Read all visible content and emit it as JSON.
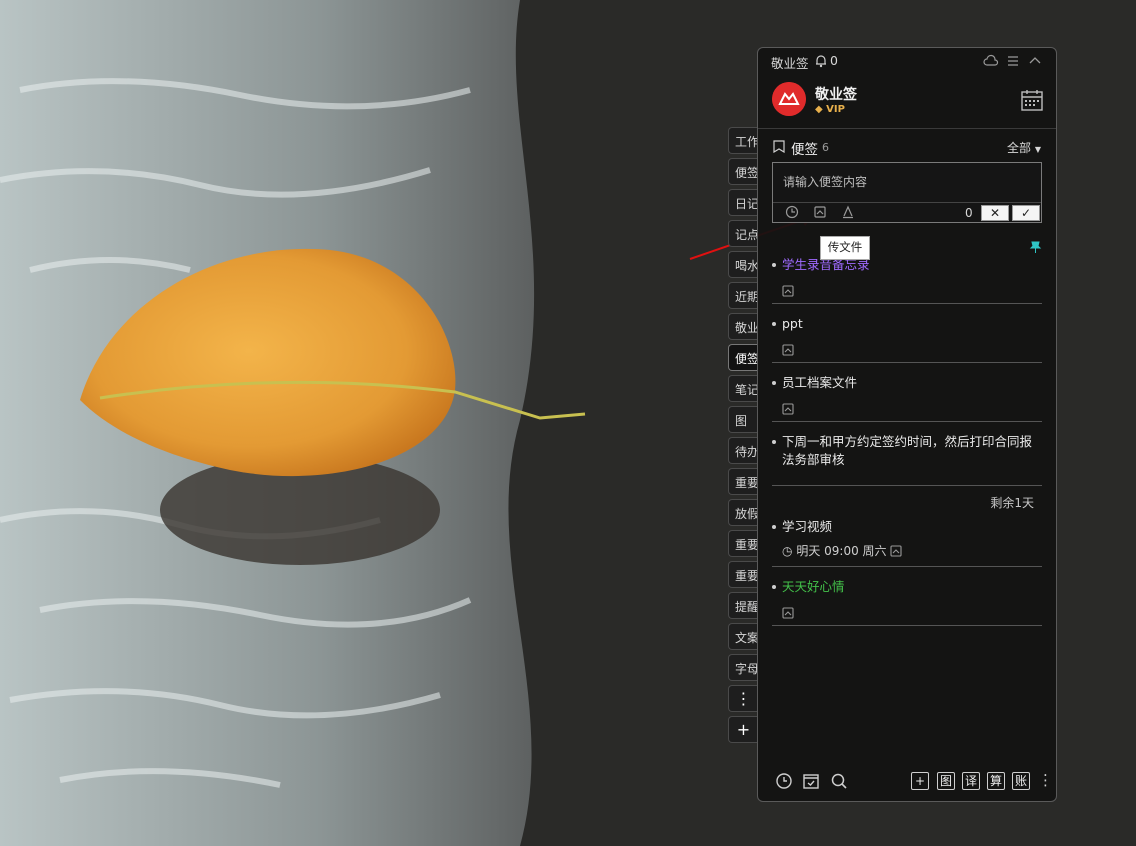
{
  "side_tabs": [
    "工作",
    "便签",
    "日记",
    "记点",
    "喝水",
    "近期",
    "敬业",
    "便签",
    "笔记",
    "图",
    "待办",
    "重要",
    "放假",
    "重要",
    "重要",
    "提醒",
    "文案",
    "字母"
  ],
  "side_tabs_active_index": 7,
  "side_tab_more_label": "⋮",
  "side_tab_add_label": "+",
  "panel": {
    "app_name": "敬业签",
    "notification_count": "0",
    "user_name": "敬业签",
    "vip_badge": "VIP",
    "section_title": "便签",
    "section_count": "6",
    "filter_label": "全部",
    "editor": {
      "placeholder": "请输入便签内容",
      "char_count": "0",
      "cancel_symbol": "✕",
      "confirm_symbol": "✓"
    },
    "tooltip": "传文件",
    "notes": [
      {
        "text": "学生录音备忘录",
        "color": "#a06bff",
        "pinned": true
      },
      {
        "text": "ppt",
        "color": "#eaeaea"
      },
      {
        "text": "员工档案文件",
        "color": "#eaeaea"
      },
      {
        "text": "下周一和甲方约定签约时间，然后打印合同报法务部审核",
        "color": "#eaeaea"
      },
      {
        "text": "学习视频",
        "color": "#eaeaea",
        "remaining": "剩余1天",
        "reminder": "明天 09:00 周六"
      },
      {
        "text": "天天好心情",
        "color": "#43c14a"
      }
    ],
    "bottom_buttons": [
      "图",
      "译",
      "算",
      "账"
    ],
    "bottom_more": "⋮"
  },
  "colors": {
    "accent_red": "#e02b2b",
    "vip_gold": "#e8b04c",
    "pin_teal": "#2fc6c6"
  }
}
